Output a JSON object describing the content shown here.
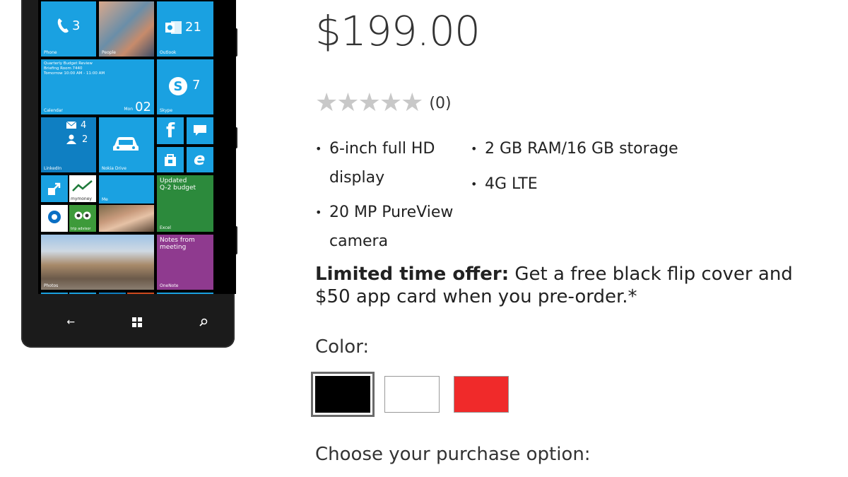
{
  "phone": {
    "tiles": {
      "phone": {
        "label": "Phone",
        "count": "3"
      },
      "people": {
        "label": "People"
      },
      "outlook": {
        "label": "Outlook",
        "count": "21"
      },
      "calendar": {
        "label": "Calendar",
        "lines": "Quarterly Budget Review\nBriefing Room 7440\nTomorrow 10:00 AM - 11:00 AM",
        "day": "Mon",
        "date": "02"
      },
      "skype": {
        "label": "Skype",
        "count": "7"
      },
      "linkedin": {
        "label": "LinkedIn",
        "msg_count": "4",
        "people_count": "2"
      },
      "nokia_drive": {
        "label": "Nokia Drive"
      },
      "mymoney": {
        "label": "mymoney"
      },
      "me": {
        "label": "Me"
      },
      "excel": {
        "label": "Excel",
        "text": "Updated\nQ-2 budget"
      },
      "onenote": {
        "label": "OneNote",
        "text": "Notes from\nmeeting"
      },
      "photos": {
        "label": "Photos"
      },
      "tripadvisor": {
        "label": "trip advisor"
      }
    }
  },
  "product": {
    "price": "$199.00",
    "rating": {
      "stars": 5,
      "filled": 0,
      "count": "(0)"
    },
    "features": [
      "6-inch full HD display",
      "2 GB RAM/16 GB storage",
      "4G LTE",
      "20 MP PureView camera"
    ],
    "feature_lines": {
      "f1a": "6-inch full HD",
      "f1b": "display",
      "f2": "2 GB RAM/16 GB storage",
      "f3": "4G LTE",
      "f4a": "20 MP PureView",
      "f4b": "camera"
    },
    "offer": {
      "bold": "Limited time offer:",
      "line1": " Get a free black flip cover and",
      "line2": "$50 app card when you pre-order.*"
    },
    "color_label": "Color:",
    "colors": [
      {
        "name": "black",
        "hex": "#000000",
        "selected": true
      },
      {
        "name": "white",
        "hex": "#ffffff",
        "selected": false
      },
      {
        "name": "red",
        "hex": "#f02a2a",
        "selected": false
      }
    ],
    "purchase_label": "Choose your purchase option:"
  }
}
